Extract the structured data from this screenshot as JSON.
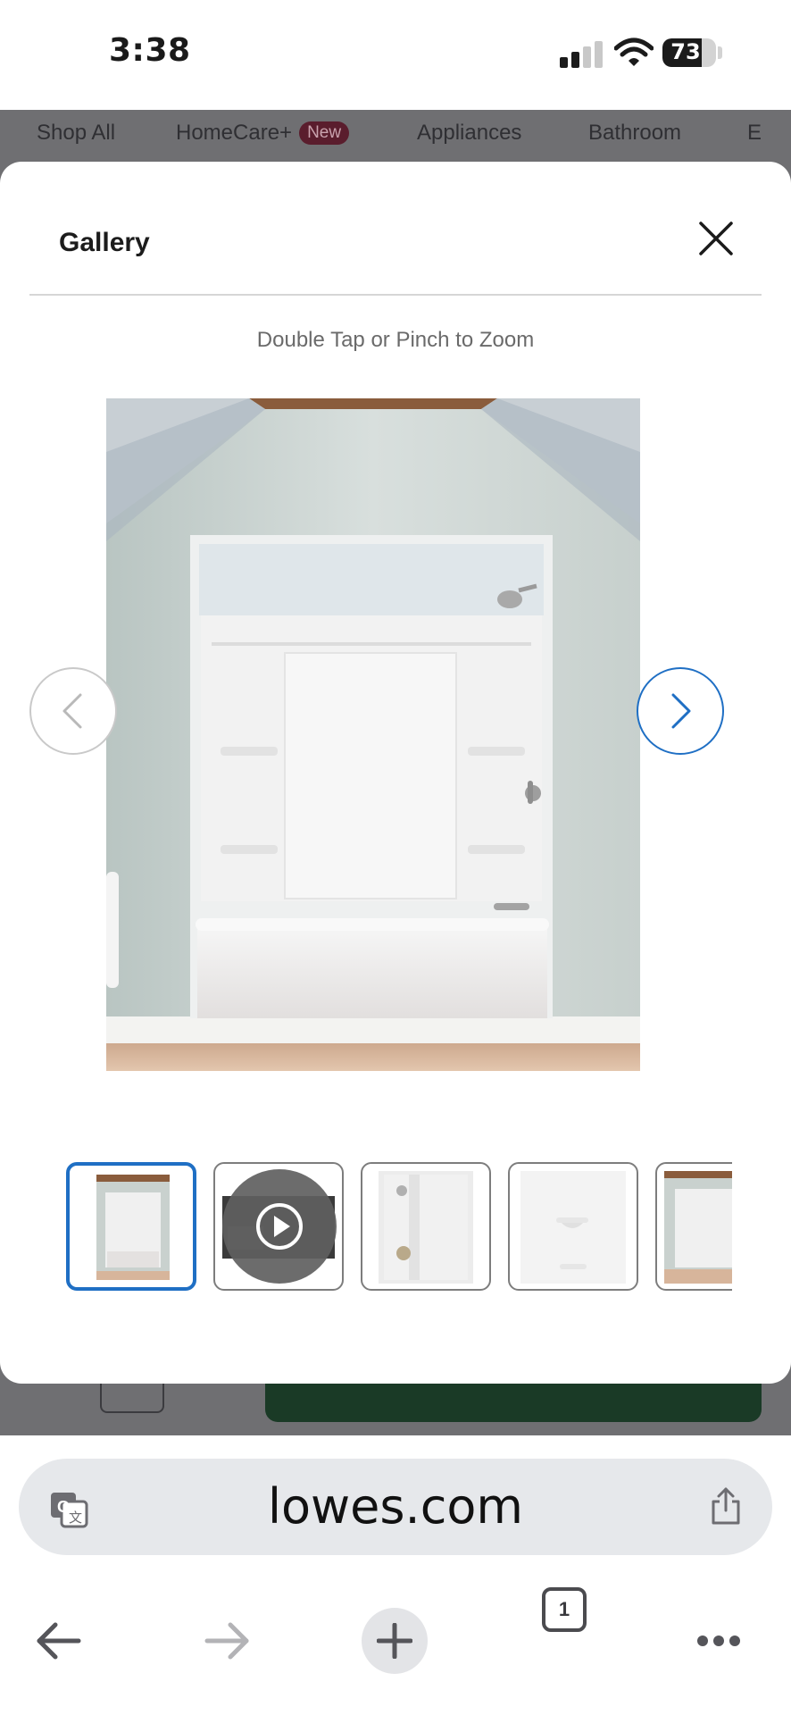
{
  "status_bar": {
    "time": "3:38",
    "battery_level": "73",
    "battery_fraction": 0.73,
    "signal_bars_active": 2,
    "signal_bars_total": 4
  },
  "category_nav": {
    "items": [
      "Shop All",
      "HomeCare+",
      "Appliances",
      "Bathroom",
      "E"
    ],
    "badge": "New"
  },
  "gallery": {
    "title": "Gallery",
    "zoom_hint": "Double Tap or Pinch to Zoom",
    "selected_index": 0,
    "thumbnails": [
      {
        "kind": "image",
        "icon": "tub-shower-thumb"
      },
      {
        "kind": "video",
        "icon": "play-icon"
      },
      {
        "kind": "image",
        "icon": "shower-detail-thumb"
      },
      {
        "kind": "image",
        "icon": "shelf-detail-thumb"
      },
      {
        "kind": "image",
        "icon": "tub-shower-thumb"
      }
    ]
  },
  "browser": {
    "url": "lowes.com",
    "open_tab_count": "1",
    "accent_color": "#1f6fc4"
  }
}
